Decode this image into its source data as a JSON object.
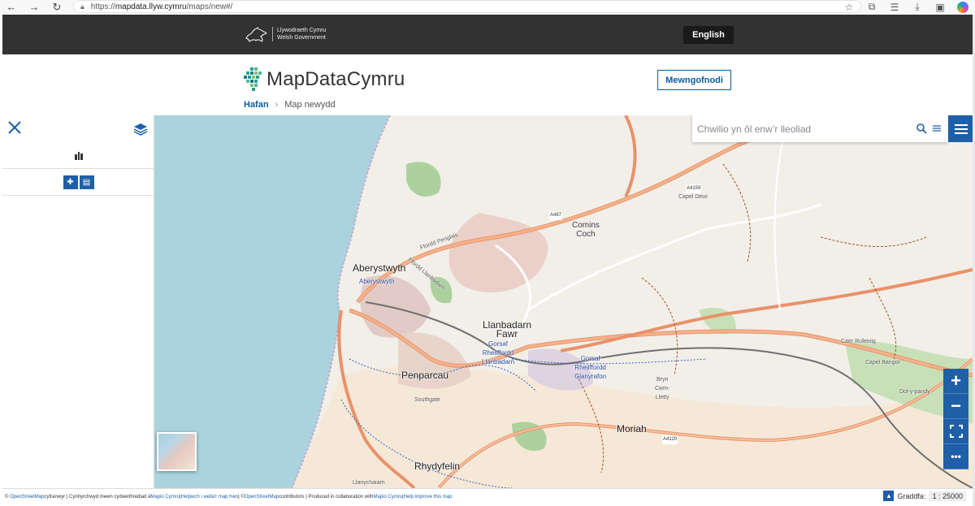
{
  "browser": {
    "url_prefix": "https://",
    "url_host": "mapdata.llyw.cymru",
    "url_path": "/maps/new#/"
  },
  "gov": {
    "logo_line1": "Llywodraeth Cymru",
    "logo_line2": "Welsh Government",
    "language_button": "English"
  },
  "site": {
    "brand": "MapDataCymru",
    "login_button": "Mewngofnodi",
    "breadcrumb_home": "Hafan",
    "breadcrumb_separator": "›",
    "breadcrumb_current": "Map newydd"
  },
  "map": {
    "search_placeholder": "Chwilio yn ôl enw’r lleoliad",
    "zoom_in": "+",
    "zoom_out": "−",
    "more": "•••",
    "labels": {
      "aberystwyth": "Aberystwyth",
      "aberystwyth_station": "Aberystwyth",
      "comins_coch": "Comins\nCoch",
      "capel_dewi": "Capel Dewi",
      "llanbadarn": "Llanbadarn\nFawr",
      "gorsaf_llanbadarn": "Gorsaf\nRheilffordd\nLlanbadarn",
      "gorsaf_glanyrafon": "Gorsaf\nRheilffordd\nGlanyrafon",
      "penparcau": "Penparcau",
      "southgate": "Southgate",
      "moriah": "Moriah",
      "rhydyfelin": "Rhydyfelin",
      "llanychaiarn": "Llanychaiarn",
      "caer_rufeinig": "Caer Rufeinig",
      "capel_bangor": "Capel Bangor",
      "dol_y_pandy": "Dol-y-pandy",
      "bryn_cwm_lletty": "Bryn\nCwm-\nLletty",
      "a487": "A487",
      "a4159": "A4159",
      "a4120": "A4120",
      "ffordd_penglais": "Ffordd Penglais",
      "ffordd_llanbadarn": "Ffordd Llanbadarn"
    }
  },
  "footer": {
    "osm_link": "OpenStreetMap",
    "text1": " cyfranwyr | Cynhyrchwyd mewn cydweithrediad â ",
    "mapio_link": "Mapio Cymru",
    "sep1": " | ",
    "help_link": "Helpwch i wella'r map hwn",
    "sep2": " | © ",
    "osm_link2": "OpenStreetMap",
    "text2": " contributors | Produced in collaboration with ",
    "mapio_link2": "Mapio Cymru",
    "sep3": " | ",
    "improve_link": "Help improve this map",
    "copyright": "©",
    "scale_label": "Graddfa:",
    "scale_value": "1 : 25000"
  }
}
